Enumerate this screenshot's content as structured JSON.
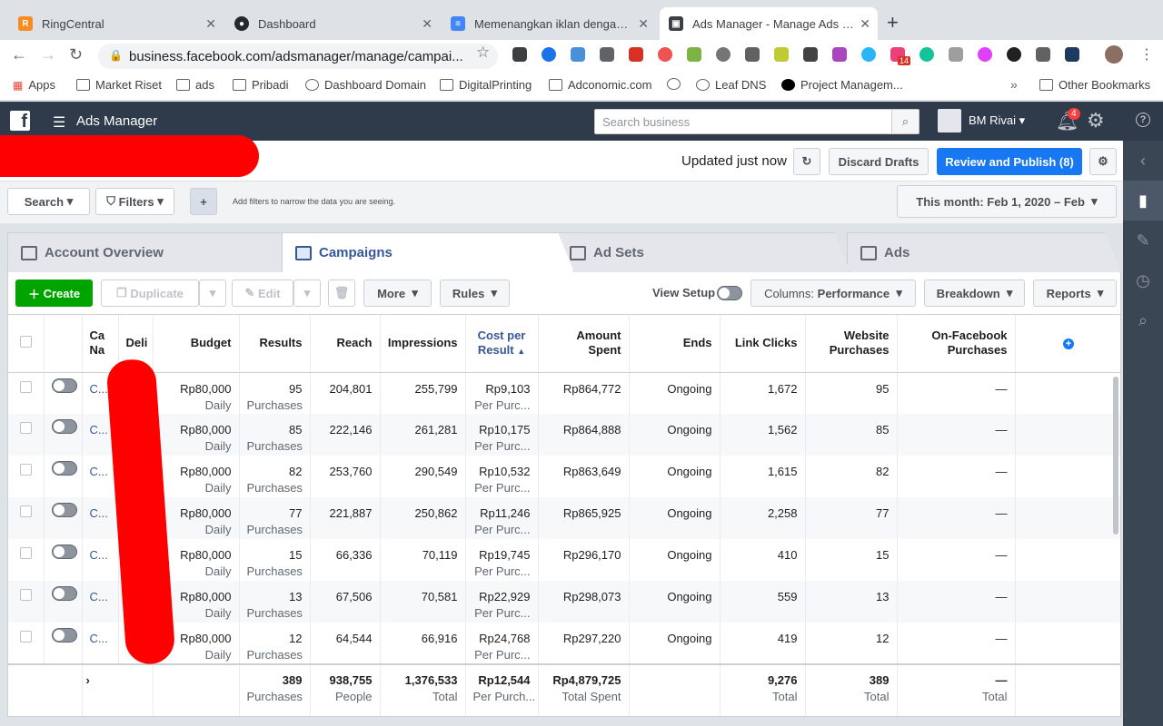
{
  "browser": {
    "tabs": [
      {
        "title": "RingCentral",
        "icon": "ringcentral-icon",
        "color": "#f68b1f",
        "active": false
      },
      {
        "title": "Dashboard",
        "icon": "github-icon",
        "color": "#24292e",
        "active": false
      },
      {
        "title": "Memenangkan iklan dengan ko",
        "icon": "docs-icon",
        "color": "#4285f4",
        "active": false
      },
      {
        "title": "Ads Manager - Manage Ads - C",
        "icon": "ads-manager-icon",
        "color": "#3c4043",
        "active": true
      }
    ],
    "url": "business.facebook.com/adsmanager/manage/campai...",
    "bookmarks": [
      "Apps",
      "Market Riset",
      "ads",
      "Pribadi",
      "Dashboard Domain",
      "DigitalPrinting",
      "Adconomic.com",
      "",
      "Leaf DNS",
      "Project Managem...",
      "Other Bookmarks"
    ],
    "extension_badge": "14"
  },
  "header": {
    "title": "Ads Manager",
    "search_placeholder": "Search business",
    "business_name": "BM Rivai",
    "notification_count": "4"
  },
  "subheader": {
    "updated": "Updated just now",
    "discard": "Discard Drafts",
    "review": "Review and Publish (8)"
  },
  "filters": {
    "search": "Search",
    "filters": "Filters",
    "hint": "Add filters to narrow the data you are seeing.",
    "date_range": "This month: Feb 1, 2020 – Feb"
  },
  "tabs": [
    "Account Overview",
    "Campaigns",
    "Ad Sets",
    "Ads"
  ],
  "toolbar": {
    "create": "Create",
    "duplicate": "Duplicate",
    "edit": "Edit",
    "more": "More",
    "rules": "Rules",
    "view_setup": "View Setup",
    "columns_label": "Columns:",
    "columns_value": "Performance",
    "breakdown": "Breakdown",
    "reports": "Reports"
  },
  "table": {
    "headers": {
      "name": "Ca Na",
      "delivery": "Deli",
      "budget": "Budget",
      "results": "Results",
      "reach": "Reach",
      "impressions": "Impressions",
      "cost": "Cost per Result",
      "amount": "Amount Spent",
      "ends": "Ends",
      "clicks": "Link Clicks",
      "website": "Website Purchases",
      "onfb": "On-Facebook Purchases"
    },
    "rows": [
      {
        "name": "C...",
        "budget": "Rp80,000",
        "budget_sub": "Daily",
        "results": "95",
        "results_sub": "Purchases",
        "reach": "204,801",
        "impressions": "255,799",
        "cost": "Rp9,103",
        "cost_sub": "Per Purc...",
        "amount": "Rp864,772",
        "ends": "Ongoing",
        "clicks": "1,672",
        "website": "95",
        "onfb": "—"
      },
      {
        "name": "C...",
        "budget": "Rp80,000",
        "budget_sub": "Daily",
        "results": "85",
        "results_sub": "Purchases",
        "reach": "222,146",
        "impressions": "261,281",
        "cost": "Rp10,175",
        "cost_sub": "Per Purc...",
        "amount": "Rp864,888",
        "ends": "Ongoing",
        "clicks": "1,562",
        "website": "85",
        "onfb": "—"
      },
      {
        "name": "C...",
        "budget": "Rp80,000",
        "budget_sub": "Daily",
        "results": "82",
        "results_sub": "Purchases",
        "reach": "253,760",
        "impressions": "290,549",
        "cost": "Rp10,532",
        "cost_sub": "Per Purc...",
        "amount": "Rp863,649",
        "ends": "Ongoing",
        "clicks": "1,615",
        "website": "82",
        "onfb": "—"
      },
      {
        "name": "C...",
        "budget": "Rp80,000",
        "budget_sub": "Daily",
        "results": "77",
        "results_sub": "Purchases",
        "reach": "221,887",
        "impressions": "250,862",
        "cost": "Rp11,246",
        "cost_sub": "Per Purc...",
        "amount": "Rp865,925",
        "ends": "Ongoing",
        "clicks": "2,258",
        "website": "77",
        "onfb": "—"
      },
      {
        "name": "C...",
        "budget": "Rp80,000",
        "budget_sub": "Daily",
        "results": "15",
        "results_sub": "Purchases",
        "reach": "66,336",
        "impressions": "70,119",
        "cost": "Rp19,745",
        "cost_sub": "Per Purc...",
        "amount": "Rp296,170",
        "ends": "Ongoing",
        "clicks": "410",
        "website": "15",
        "onfb": "—"
      },
      {
        "name": "C...",
        "budget": "Rp80,000",
        "budget_sub": "Daily",
        "results": "13",
        "results_sub": "Purchases",
        "reach": "67,506",
        "impressions": "70,581",
        "cost": "Rp22,929",
        "cost_sub": "Per Purc...",
        "amount": "Rp298,073",
        "ends": "Ongoing",
        "clicks": "559",
        "website": "13",
        "onfb": "—"
      },
      {
        "name": "C...",
        "budget": "Rp80,000",
        "budget_sub": "Daily",
        "results": "12",
        "results_sub": "Purchases",
        "reach": "64,544",
        "impressions": "66,916",
        "cost": "Rp24,768",
        "cost_sub": "Per Purc...",
        "amount": "Rp297,220",
        "ends": "Ongoing",
        "clicks": "419",
        "website": "12",
        "onfb": "—"
      }
    ],
    "totals": {
      "results": "389",
      "results_sub": "Purchases",
      "reach": "938,755",
      "reach_sub": "People",
      "impressions": "1,376,533",
      "impressions_sub": "Total",
      "cost": "Rp12,544",
      "cost_sub": "Per Purch...",
      "amount": "Rp4,879,725",
      "amount_sub": "Total Spent",
      "clicks": "9,276",
      "clicks_sub": "Total",
      "website": "389",
      "website_sub": "Total",
      "onfb": "—",
      "onfb_sub": "Total"
    }
  },
  "colors": {
    "accent": "#1877f2",
    "create": "#00a400",
    "header": "#2f3b4a",
    "redaction": "#ff0000"
  }
}
